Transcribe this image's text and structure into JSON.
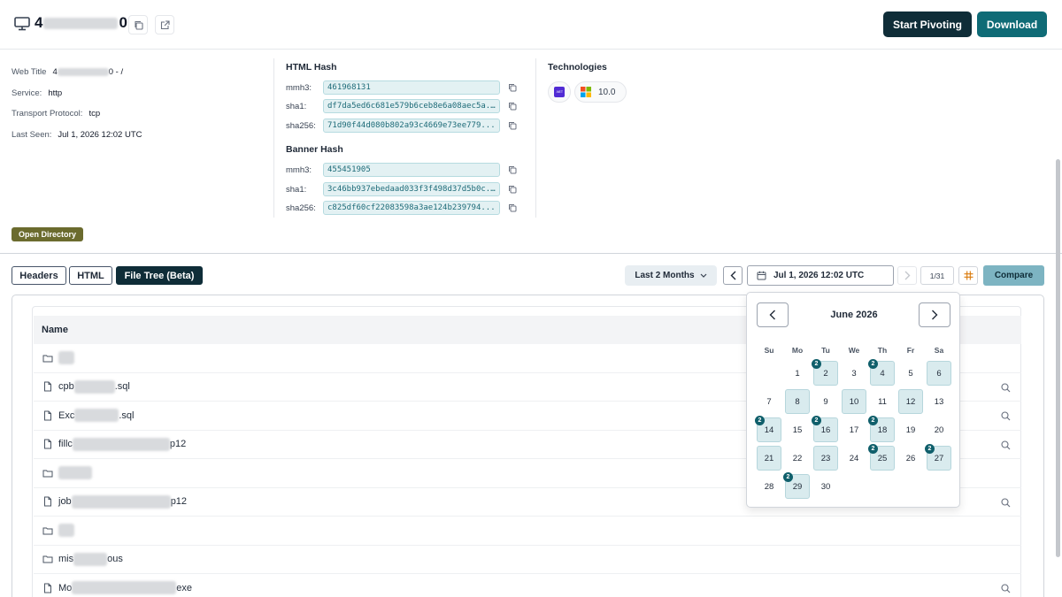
{
  "header": {
    "host_prefix": "4",
    "host_suffix": "0",
    "start_pivoting": "Start Pivoting",
    "download": "Download"
  },
  "info": {
    "web_title_label": "Web Title",
    "web_title_prefix": "4",
    "web_title_suffix": "0 - /",
    "service_label": "Service:",
    "service_value": "http",
    "transport_label": "Transport Protocol:",
    "transport_value": "tcp",
    "last_seen_label": "Last Seen:",
    "last_seen_value": "Jul 1, 2026 12:02 UTC",
    "badge": "Open Directory"
  },
  "html_hash": {
    "title": "HTML Hash",
    "rows": [
      {
        "label": "mmh3:",
        "value": "461968131"
      },
      {
        "label": "sha1:",
        "value": "df7da5ed6c681e579b6ceb8e6a08aec5a..."
      },
      {
        "label": "sha256:",
        "value": "71d90f44d080b802a93c4669e73ee779..."
      }
    ]
  },
  "banner_hash": {
    "title": "Banner Hash",
    "rows": [
      {
        "label": "mmh3:",
        "value": "455451905"
      },
      {
        "label": "sha1:",
        "value": "3c46bb937ebedaad033f3f498d37d5b0c..."
      },
      {
        "label": "sha256:",
        "value": "c825df60cf22083598a3ae124b239794..."
      }
    ]
  },
  "technologies": {
    "title": "Technologies",
    "net_icon": ".NET",
    "windows_version": "10.0"
  },
  "tabs": [
    "Headers",
    "HTML",
    "File Tree (Beta)"
  ],
  "toolbar": {
    "range": "Last 2 Months",
    "date": "Jul 1, 2026 12:02 UTC",
    "page": "1/31",
    "compare": "Compare"
  },
  "tree": {
    "header": "Name",
    "rows": [
      {
        "type": "folder",
        "prefix": "",
        "suffix": ""
      },
      {
        "type": "file",
        "prefix": "cpb",
        "suffix": ".sql"
      },
      {
        "type": "file",
        "prefix": "Exc",
        "suffix": ".sql"
      },
      {
        "type": "file",
        "prefix": "fillc",
        "suffix": "p12"
      },
      {
        "type": "folder",
        "prefix": "",
        "suffix": ""
      },
      {
        "type": "file",
        "prefix": "job",
        "suffix": "p12"
      },
      {
        "type": "folder",
        "prefix": "",
        "suffix": ""
      },
      {
        "type": "folder",
        "prefix": "mis",
        "suffix": "ous"
      },
      {
        "type": "file",
        "prefix": "Mo",
        "suffix": "exe"
      }
    ]
  },
  "calendar": {
    "title": "June 2026",
    "weekdays": [
      "Su",
      "Mo",
      "Tu",
      "We",
      "Th",
      "Fr",
      "Sa"
    ],
    "first_weekday": 1,
    "days_in_month": 30,
    "marked": [
      2,
      4,
      6,
      8,
      10,
      12,
      14,
      16,
      18,
      21,
      23,
      25,
      27,
      29
    ],
    "counts": {
      "2": "2",
      "4": "2",
      "14": "2",
      "16": "2",
      "18": "2",
      "25": "2",
      "27": "2",
      "29": "2"
    }
  }
}
